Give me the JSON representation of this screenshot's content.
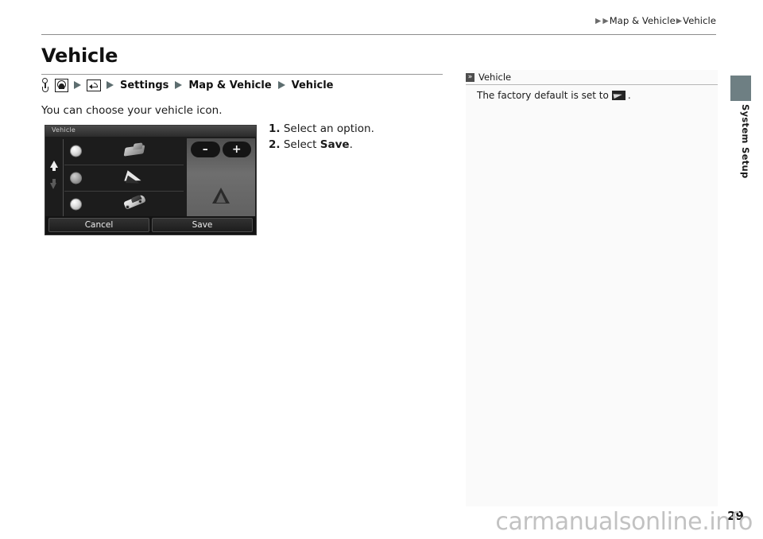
{
  "header": {
    "breadcrumb": [
      "Map & Vehicle",
      "Vehicle"
    ],
    "triangle_glyph": "▶"
  },
  "page": {
    "title": "Vehicle",
    "number": "29",
    "watermark": "carmanualsonline.info"
  },
  "nav_path": {
    "icons": [
      "key-hook-icon",
      "nav-compass-icon",
      "back-arrow-icon"
    ],
    "steps": [
      "Settings",
      "Map & Vehicle",
      "Vehicle"
    ]
  },
  "content": {
    "intro": "You can choose your vehicle icon.",
    "steps": [
      {
        "num": "1.",
        "text_before": "Select an option.",
        "strong": "",
        "text_after": ""
      },
      {
        "num": "2.",
        "text_before": "Select ",
        "strong": "Save",
        "text_after": "."
      }
    ]
  },
  "navshot": {
    "title": "Vehicle",
    "scroll_up": "scroll-up-arrow",
    "scroll_down": "scroll-down-arrow",
    "options": [
      {
        "icon": "truck-vehicle-icon",
        "selected": false
      },
      {
        "icon": "arrow-vehicle-icon",
        "selected": true
      },
      {
        "icon": "sportscar-vehicle-icon",
        "selected": false
      }
    ],
    "map": {
      "zoom_out": "–",
      "zoom_in": "+",
      "marker": "vehicle-position-marker"
    },
    "buttons": {
      "cancel": "Cancel",
      "save": "Save"
    }
  },
  "note": {
    "chevron": "»",
    "title": "Vehicle",
    "text_before": "The factory default is set to",
    "icon": "default-vehicle-arrow-icon",
    "text_after": "."
  },
  "side_tab": {
    "label": "System Setup",
    "color": "#6e7f83"
  },
  "colors": {
    "page_bg": "#ffffff",
    "rule": "#8d8d8d",
    "note_bg": "#fafafa",
    "path_triangle": "#5d6d6f",
    "watermark": "#c2c2c2"
  }
}
